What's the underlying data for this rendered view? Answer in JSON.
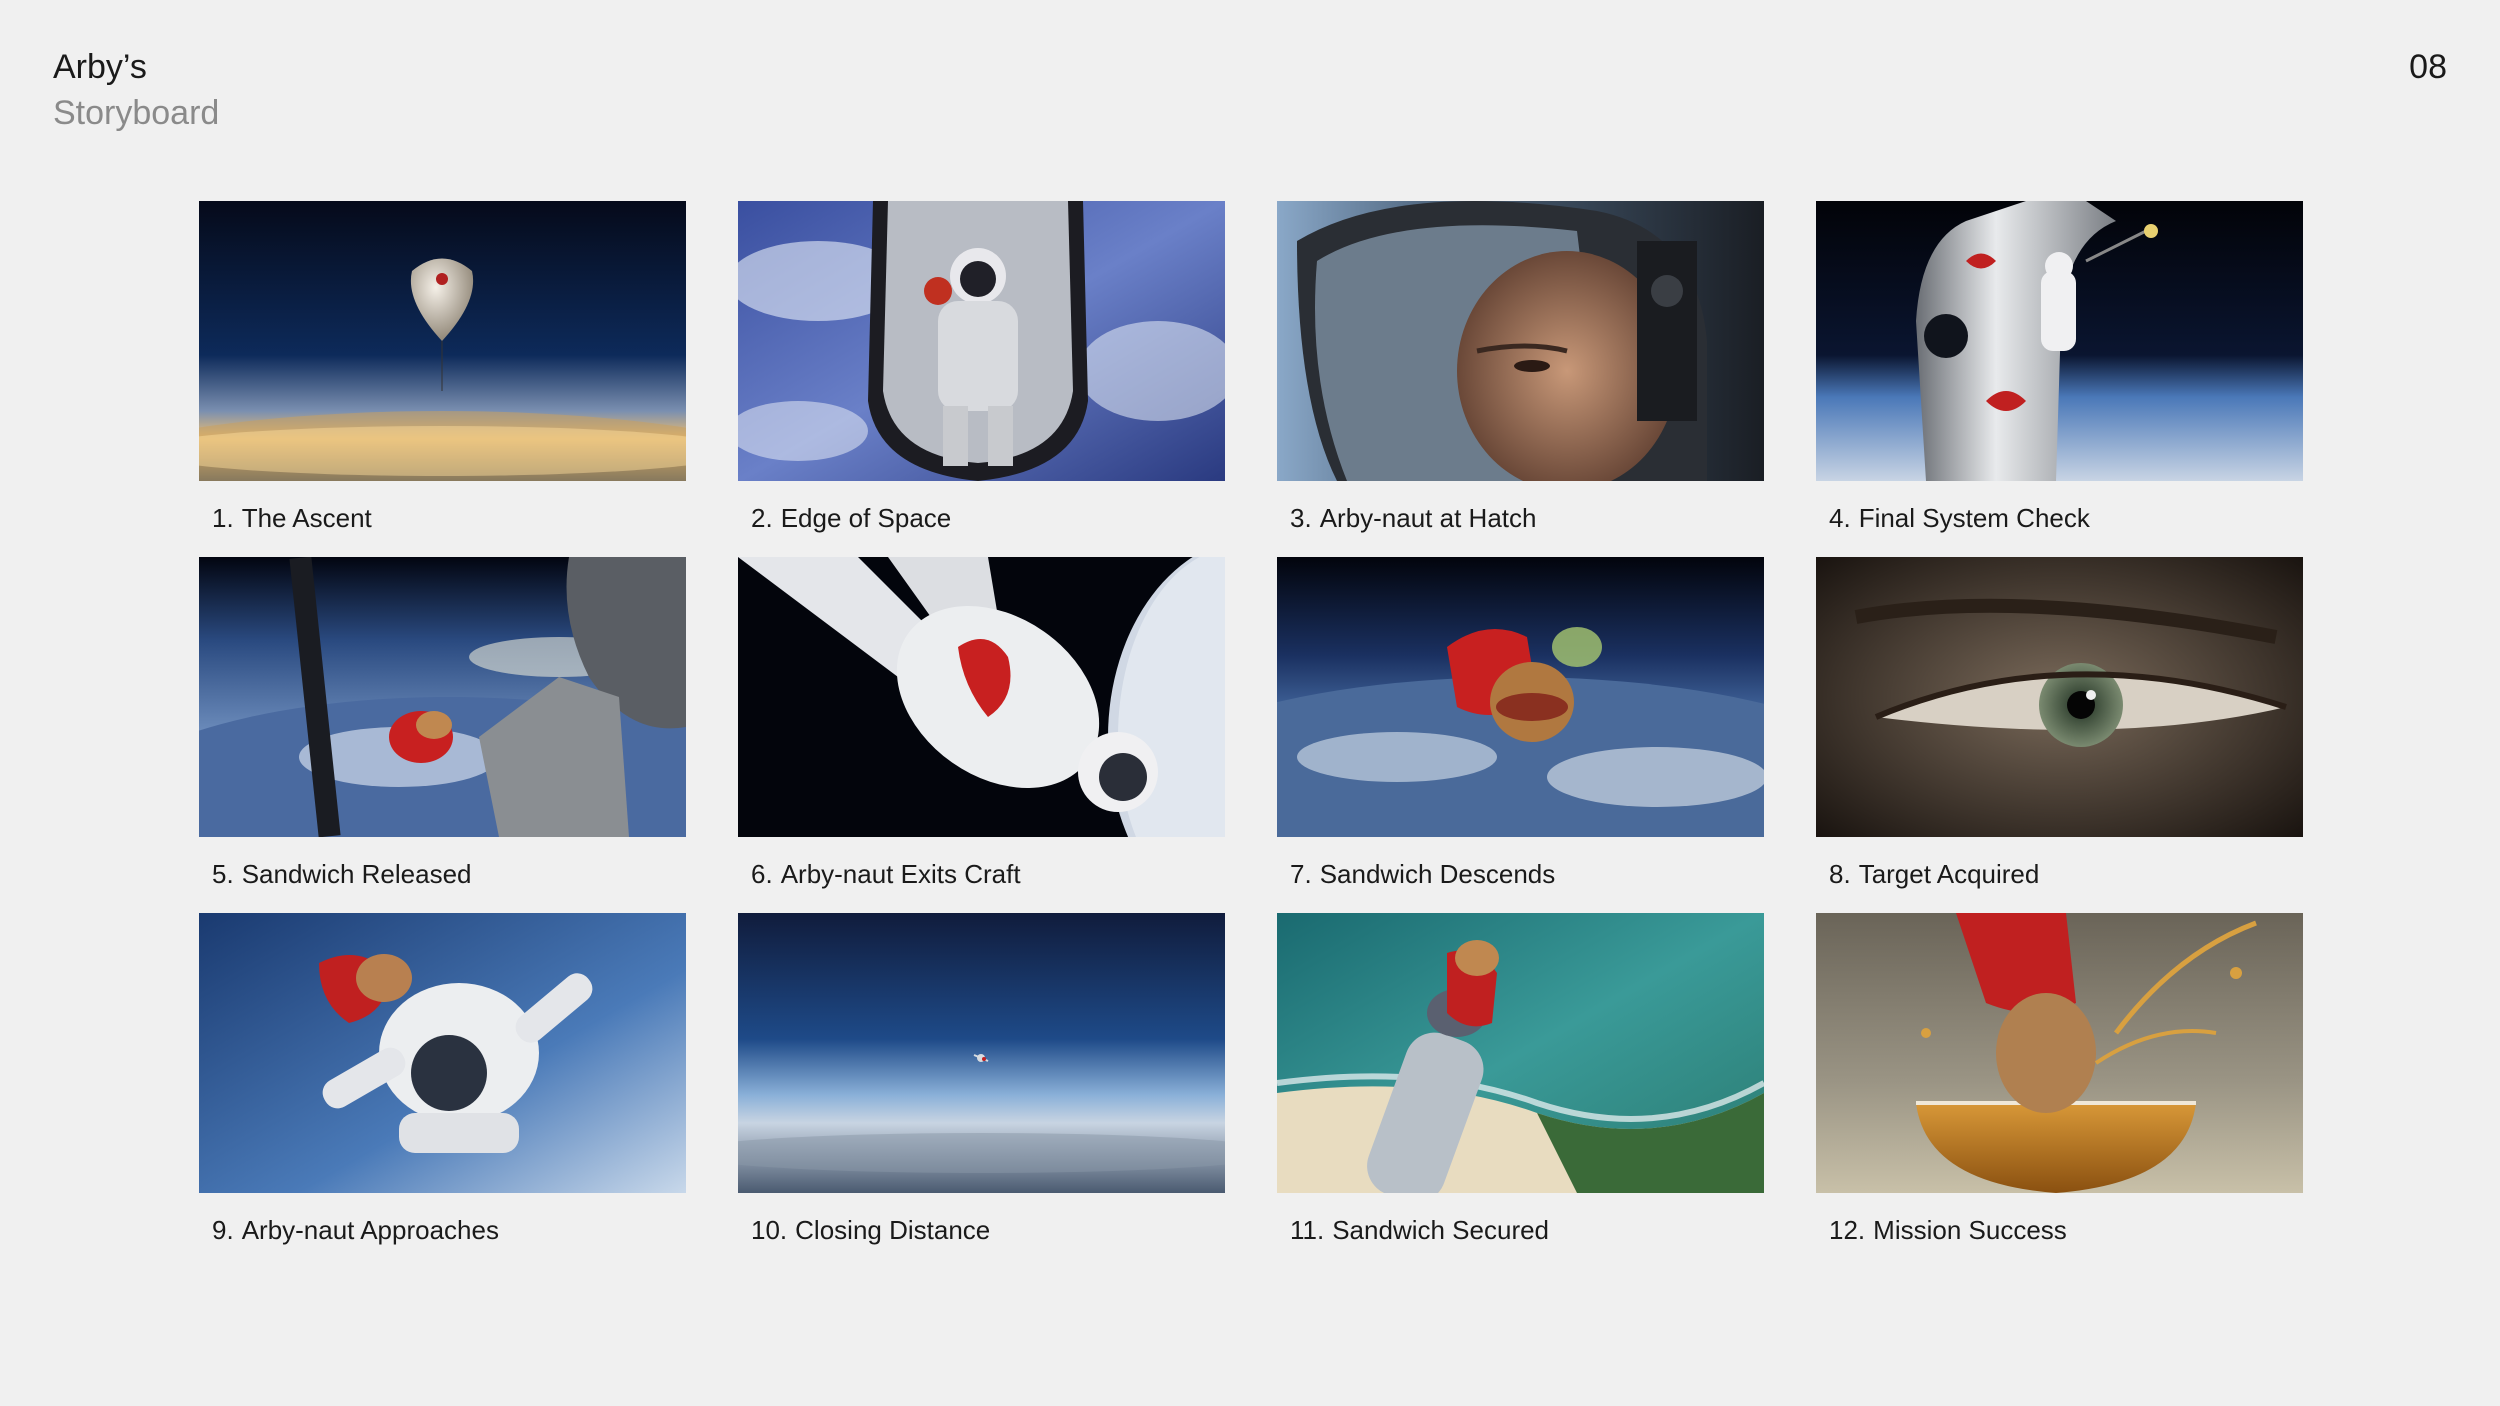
{
  "header": {
    "title": "Arby’s",
    "subtitle": "Storyboard",
    "page_number": "08"
  },
  "frames": [
    {
      "num": "1.",
      "label": "The Ascent",
      "image": "stratosphere-balloon-over-earth"
    },
    {
      "num": "2.",
      "label": "Edge of Space",
      "image": "astronaut-in-capsule-hatch"
    },
    {
      "num": "3.",
      "label": "Arby-naut at Hatch",
      "image": "helmet-closeup-face"
    },
    {
      "num": "4.",
      "label": "Final System Check",
      "image": "arbys-capsule-astronaut"
    },
    {
      "num": "5.",
      "label": "Sandwich Released",
      "image": "sandwich-through-window"
    },
    {
      "num": "6.",
      "label": "Arby-naut Exits Craft",
      "image": "astronaut-jumping-from-craft"
    },
    {
      "num": "7.",
      "label": "Sandwich Descends",
      "image": "sandwich-falling-over-earth"
    },
    {
      "num": "8.",
      "label": "Target Acquired",
      "image": "eye-closeup"
    },
    {
      "num": "9.",
      "label": "Arby-naut Approaches",
      "image": "astronaut-freefall-with-sandwich"
    },
    {
      "num": "10.",
      "label": "Closing Distance",
      "image": "distant-freefall-over-horizon"
    },
    {
      "num": "11.",
      "label": "Sandwich Secured",
      "image": "hand-holding-sandwich-over-coast"
    },
    {
      "num": "12.",
      "label": "Mission Success",
      "image": "sandwich-splash-into-drink"
    }
  ]
}
